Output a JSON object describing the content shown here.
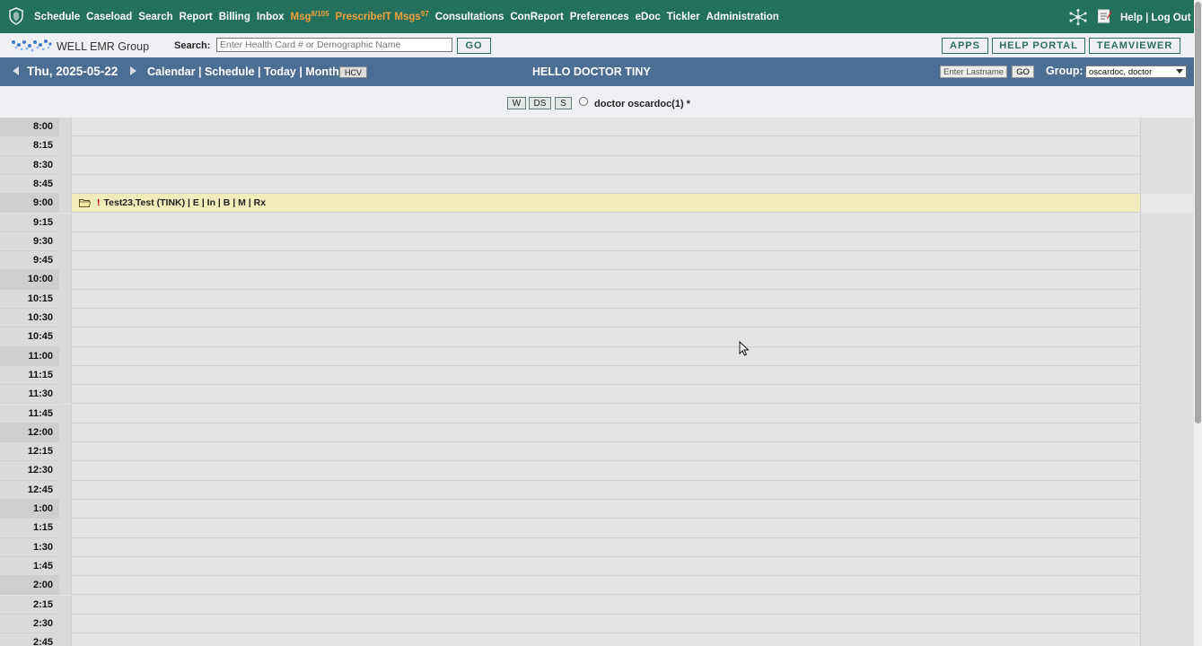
{
  "nav": {
    "items": [
      {
        "label": "Schedule",
        "sup": "",
        "color": "#ffffff"
      },
      {
        "label": "Caseload",
        "sup": "",
        "color": "#ffffff"
      },
      {
        "label": "Search",
        "sup": "",
        "color": "#ffffff"
      },
      {
        "label": "Report",
        "sup": "",
        "color": "#ffffff"
      },
      {
        "label": "Billing",
        "sup": "",
        "color": "#ffffff"
      },
      {
        "label": "Inbox",
        "sup": "",
        "color": "#ffffff"
      },
      {
        "label": "Msg",
        "sup": "8/105",
        "color": "#f3a13c"
      },
      {
        "label": "PrescribeIT Msgs",
        "sup": "97",
        "color": "#f3a13c"
      },
      {
        "label": "Consultations",
        "sup": "",
        "color": "#ffffff"
      },
      {
        "label": "ConReport",
        "sup": "",
        "color": "#ffffff"
      },
      {
        "label": "Preferences",
        "sup": "",
        "color": "#ffffff"
      },
      {
        "label": "eDoc",
        "sup": "",
        "color": "#ffffff"
      },
      {
        "label": "Tickler",
        "sup": "",
        "color": "#ffffff"
      },
      {
        "label": "Administration",
        "sup": "",
        "color": "#ffffff"
      }
    ],
    "help": "Help",
    "separator": " | ",
    "logout": "Log Out"
  },
  "search": {
    "logo_text": "WELL EMR Group",
    "label": "Search:",
    "placeholder": "Enter Health Card # or Demographic Name",
    "go": "GO",
    "apps": "APPS",
    "help_portal": "HELP PORTAL",
    "teamviewer": "TEAMVIEWER"
  },
  "datebar": {
    "date": "Thu, 2025-05-22",
    "views": [
      "Calendar",
      "Schedule",
      "Today",
      "Month"
    ],
    "view_separator": " | ",
    "hcv": "HCV",
    "greeting": "HELLO DOCTOR TINY",
    "lastname_placeholder": "Enter Lastname",
    "go": "GO",
    "group_label": "Group:",
    "group_value": "oscardoc, doctor"
  },
  "provider": {
    "buttons": [
      "W",
      "DS",
      "S"
    ],
    "name": "doctor oscardoc(1) *"
  },
  "schedule": {
    "slots": [
      "8:00",
      "8:15",
      "8:30",
      "8:45",
      "9:00",
      "9:15",
      "9:30",
      "9:45",
      "10:00",
      "10:15",
      "10:30",
      "10:45",
      "11:00",
      "11:15",
      "11:30",
      "11:45",
      "12:00",
      "12:15",
      "12:30",
      "12:45",
      "1:00",
      "1:15",
      "1:30",
      "1:45",
      "2:00",
      "2:15",
      "2:30",
      "2:45"
    ],
    "appointments": [
      {
        "slot": "9:00",
        "flag": "!",
        "text": "Test23,Test (TINK) | E | In | B | M | Rx"
      }
    ]
  },
  "colors": {
    "nav_bg": "#23705d",
    "date_bar_bg": "#4c6e93",
    "appointment_bg": "#f0ecbc",
    "msg_highlight": "#f3a13c"
  }
}
